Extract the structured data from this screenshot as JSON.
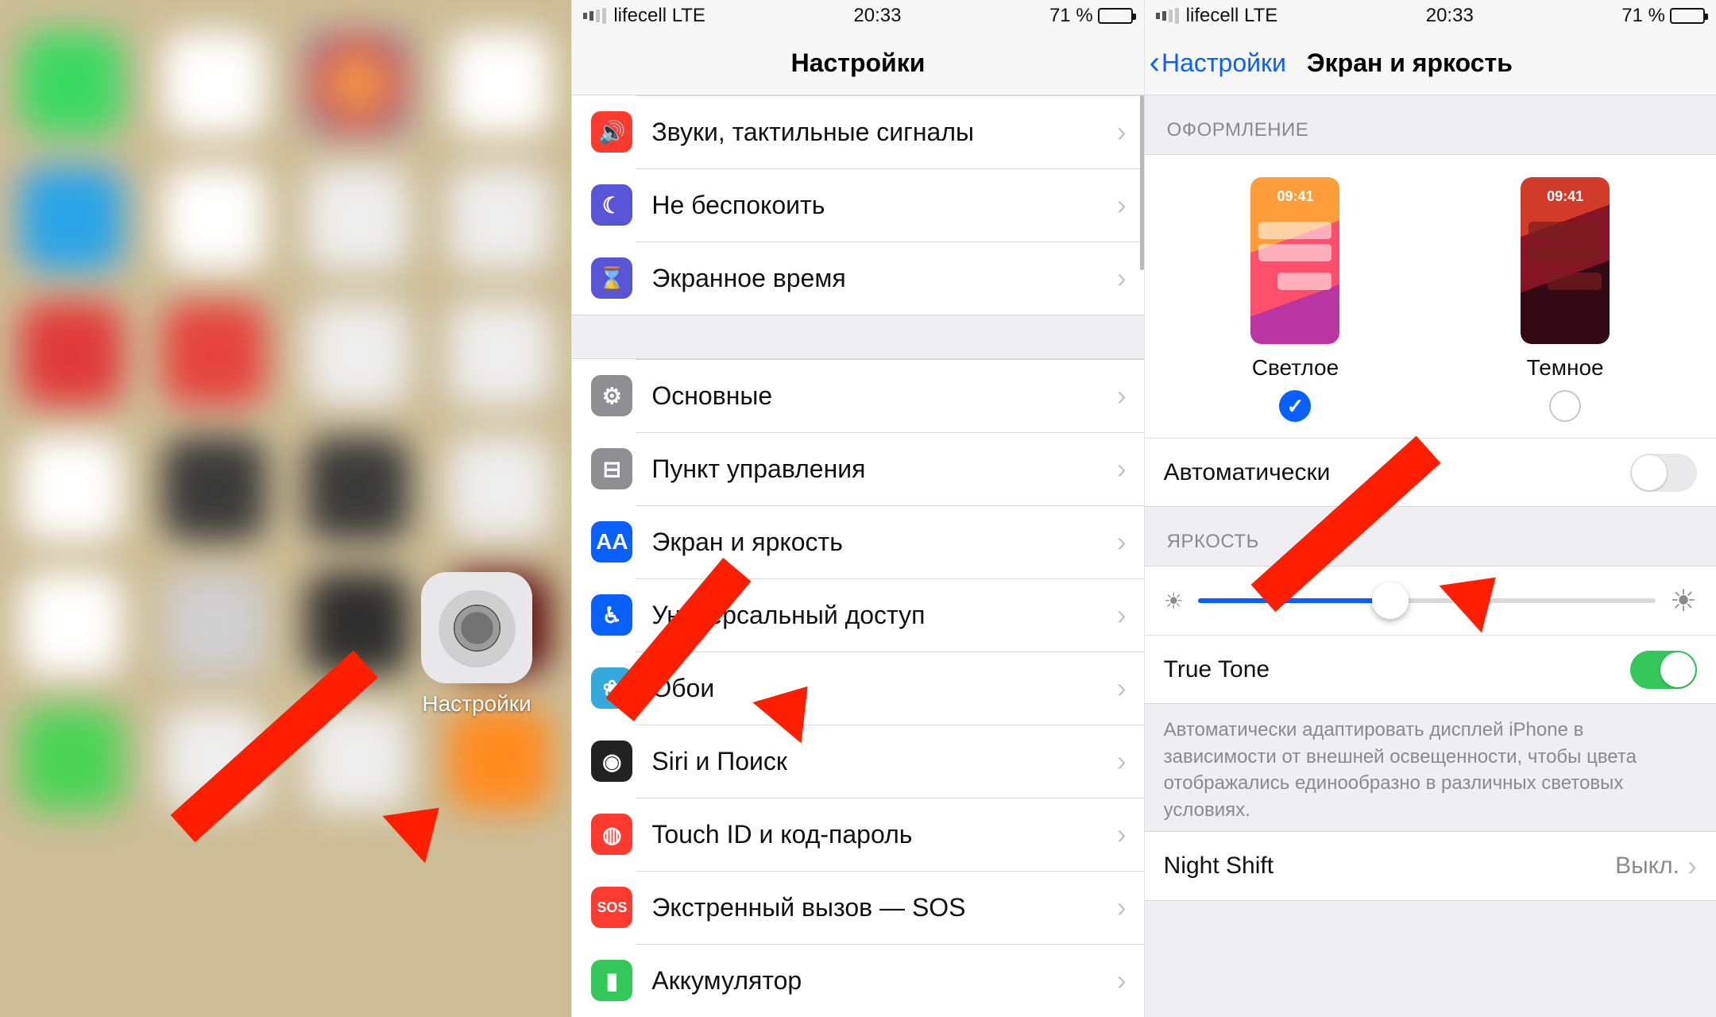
{
  "status": {
    "carrier": "lifecell  LTE",
    "time": "20:33",
    "battery_text": "71 %",
    "battery_pct": 71
  },
  "panel1": {
    "settings_label": "Настройки"
  },
  "panel2": {
    "title": "Настройки",
    "items_a": [
      {
        "label": "Звуки, тактильные сигналы",
        "color": "#ff3b30",
        "glyph": "🔊"
      },
      {
        "label": "Не беспокоить",
        "color": "#5856d6",
        "glyph": "☾"
      },
      {
        "label": "Экранное время",
        "color": "#5856d6",
        "glyph": "⌛"
      }
    ],
    "items_b": [
      {
        "label": "Основные",
        "color": "#8e8e93",
        "glyph": "⚙︎"
      },
      {
        "label": "Пункт управления",
        "color": "#8e8e93",
        "glyph": "⊟"
      },
      {
        "label": "Экран и яркость",
        "color": "#0a60ff",
        "glyph": "AA"
      },
      {
        "label": "Универсальный доступ",
        "color": "#0a60ff",
        "glyph": "♿︎"
      },
      {
        "label": "Обои",
        "color": "#34aadc",
        "glyph": "❀"
      },
      {
        "label": "Siri и Поиск",
        "color": "#222222",
        "glyph": "◉"
      },
      {
        "label": "Touch ID и код-пароль",
        "color": "#ff3b30",
        "glyph": "◍"
      },
      {
        "label": "Экстренный вызов — SOS",
        "color": "#ff3b30",
        "glyph": "SOS"
      },
      {
        "label": "Аккумулятор",
        "color": "#34c759",
        "glyph": "▮"
      }
    ]
  },
  "panel3": {
    "back": "Настройки",
    "title": "Экран и яркость",
    "section_appearance": "ОФОРМЛЕНИЕ",
    "light": "Светлое",
    "dark": "Темное",
    "thumb_time": "09:41",
    "auto_label": "Автоматически",
    "auto_on": false,
    "section_brightness": "ЯРКОСТЬ",
    "brightness_pct": 42,
    "truetone_label": "True Tone",
    "truetone_on": true,
    "truetone_note": "Автоматически адаптировать дисплей iPhone в зависимости от внешней освещенности, чтобы цвета отображались единообразно в различных световых условиях.",
    "nightshift_label": "Night Shift",
    "nightshift_value": "Выкл."
  }
}
